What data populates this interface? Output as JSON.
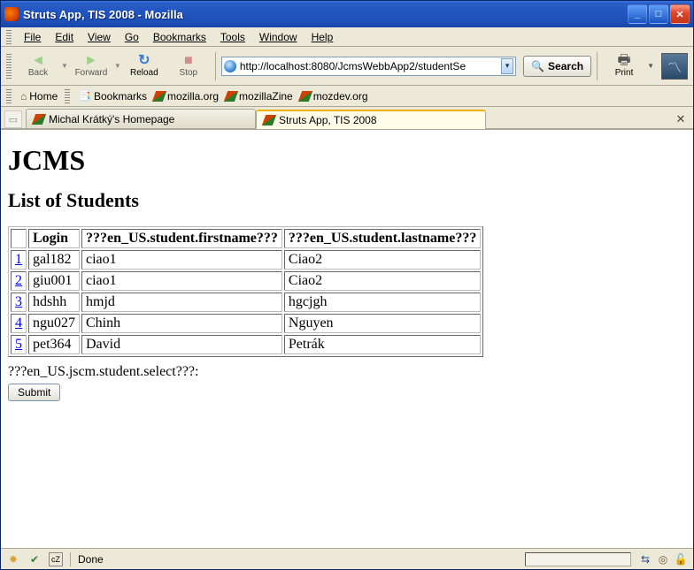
{
  "window": {
    "title": "Struts App, TIS 2008 - Mozilla"
  },
  "menu": {
    "file": "File",
    "edit": "Edit",
    "view": "View",
    "go": "Go",
    "bookmarks": "Bookmarks",
    "tools": "Tools",
    "window": "Window",
    "help": "Help"
  },
  "toolbar": {
    "back": "Back",
    "forward": "Forward",
    "reload": "Reload",
    "stop": "Stop",
    "print": "Print",
    "search": "Search",
    "url": "http://localhost:8080/JcmsWebbApp2/studentSe"
  },
  "bookmarks": {
    "home": "Home",
    "bookmarks": "Bookmarks",
    "mozorg": "mozilla.org",
    "mozzine": "mozillaZine",
    "mozdev": "mozdev.org"
  },
  "tabs": {
    "tab1": "Michal Krátký's Homepage",
    "tab2": "Struts App, TIS 2008"
  },
  "page": {
    "h1": "JCMS",
    "h2": "List of Students",
    "headers": {
      "c1": "",
      "c2": "Login",
      "c3": "???en_US.student.firstname???",
      "c4": "???en_US.student.lastname???"
    },
    "rows": [
      {
        "idx": "1",
        "login": "gal182",
        "first": "ciao1",
        "last": "Ciao2"
      },
      {
        "idx": "2",
        "login": "giu001",
        "first": "ciao1",
        "last": "Ciao2"
      },
      {
        "idx": "3",
        "login": "hdshh",
        "first": "hmjd",
        "last": "hgcjgh"
      },
      {
        "idx": "4",
        "login": "ngu027",
        "first": "Chinh",
        "last": "Nguyen"
      },
      {
        "idx": "5",
        "login": "pet364",
        "first": "David",
        "last": "Petrák"
      }
    ],
    "select_label": "???en_US.jscm.student.select???:",
    "submit": "Submit"
  },
  "status": {
    "text": "Done"
  }
}
